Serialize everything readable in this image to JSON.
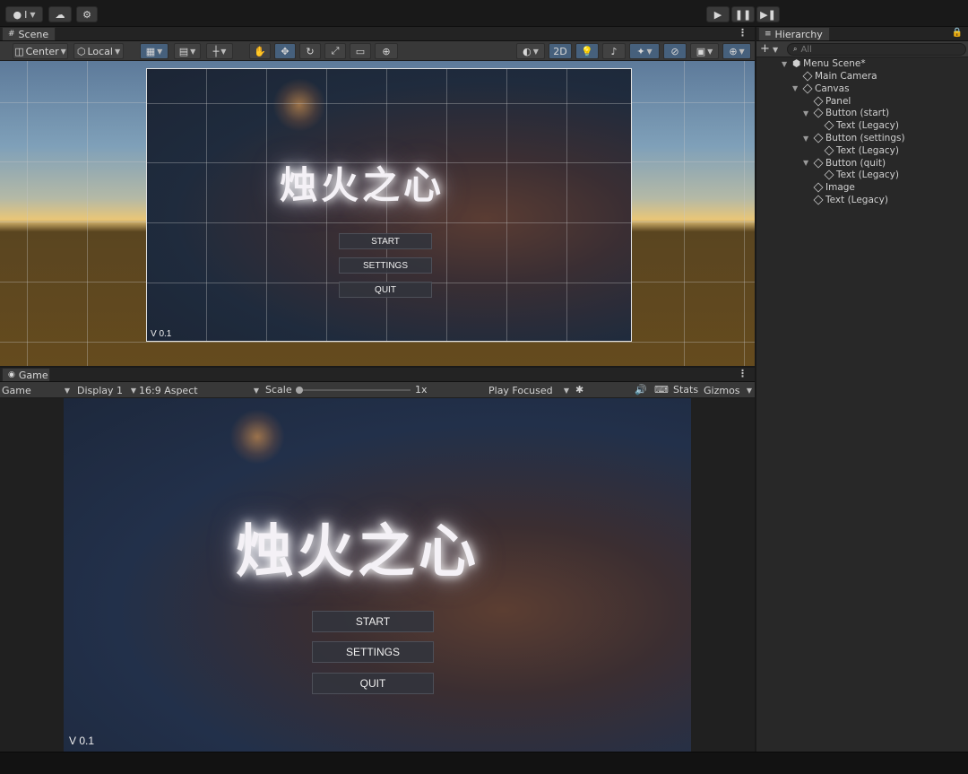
{
  "toolbar": {
    "account_label": "I",
    "play_icon": "play-icon",
    "pause_icon": "pause-icon",
    "step_icon": "step-icon"
  },
  "scene": {
    "tab_label": "Scene",
    "pivot_label": "Center",
    "space_label": "Local",
    "mode_2d": "2D"
  },
  "canvas_ui": {
    "title": "烛火之心",
    "start_label": "START",
    "settings_label": "SETTINGS",
    "quit_label": "QUIT",
    "version": "V 0.1"
  },
  "game": {
    "tab_label": "Game",
    "view_select": "Game",
    "display_select": "Display 1",
    "aspect_select": "16:9 Aspect",
    "scale_label": "Scale",
    "scale_value": "1x",
    "play_mode_select": "Play Focused",
    "stats_label": "Stats",
    "gizmos_label": "Gizmos"
  },
  "hierarchy": {
    "tab_label": "Hierarchy",
    "search_placeholder": "All",
    "scene_name": "Menu Scene*",
    "items": [
      {
        "label": "Main Camera",
        "depth": 1,
        "expandable": false
      },
      {
        "label": "Canvas",
        "depth": 1,
        "expandable": true
      },
      {
        "label": "Panel",
        "depth": 2,
        "expandable": false
      },
      {
        "label": "Button (start)",
        "depth": 2,
        "expandable": true
      },
      {
        "label": "Text (Legacy)",
        "depth": 3,
        "expandable": false
      },
      {
        "label": "Button (settings)",
        "depth": 2,
        "expandable": true
      },
      {
        "label": "Text (Legacy)",
        "depth": 3,
        "expandable": false
      },
      {
        "label": "Button (quit)",
        "depth": 2,
        "expandable": true
      },
      {
        "label": "Text (Legacy)",
        "depth": 3,
        "expandable": false
      },
      {
        "label": "Image",
        "depth": 2,
        "expandable": false
      },
      {
        "label": "Text (Legacy)",
        "depth": 2,
        "expandable": false
      }
    ]
  },
  "colors": {
    "accent_active": "#46607c",
    "panel_bg": "#282828",
    "toolbar_bg": "#383838"
  }
}
